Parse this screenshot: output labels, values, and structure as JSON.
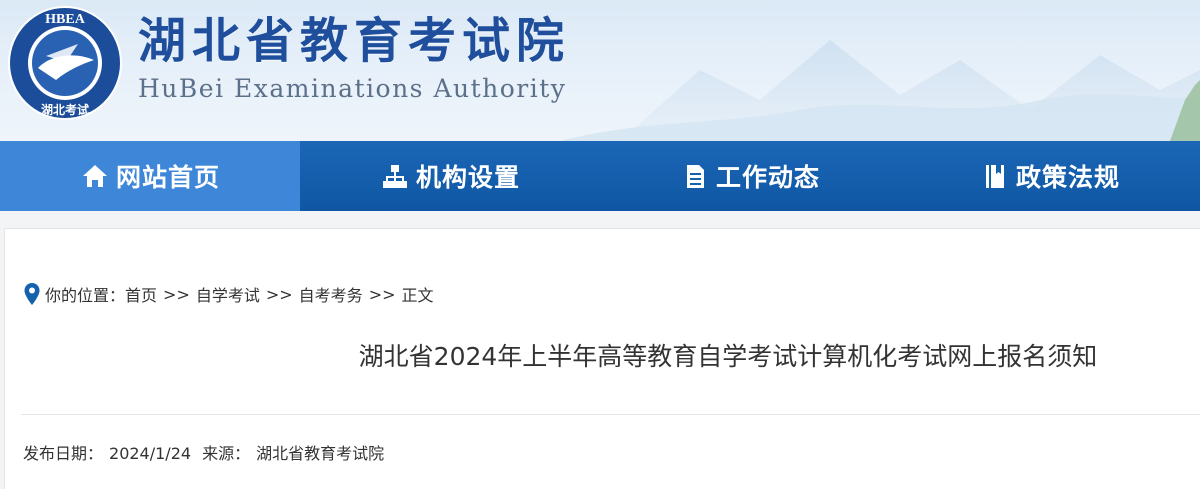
{
  "header": {
    "title": "湖北省教育考试院",
    "subtitle": "HuBei Examinations Authority",
    "logo": {
      "top_text": "HBEA",
      "bottom_text": "湖北考试"
    },
    "colors": {
      "title": "#1f4f9c",
      "subtitle": "#5d7089"
    }
  },
  "nav": {
    "items": [
      {
        "label": "网站首页",
        "icon": "home-icon",
        "active": true
      },
      {
        "label": "机构设置",
        "icon": "sitemap-icon",
        "active": false
      },
      {
        "label": "工作动态",
        "icon": "document-icon",
        "active": false
      },
      {
        "label": "政策法规",
        "icon": "book-icon",
        "active": false
      }
    ],
    "colors": {
      "bar": "#1262ae",
      "active": "#3e86d8"
    }
  },
  "breadcrumb": {
    "prefix": "你的位置：",
    "items": [
      "首页",
      "自学考试",
      "自考考务",
      "正文"
    ],
    "separator": ">>",
    "icon": "location-pin-icon"
  },
  "article": {
    "title": "湖北省2024年上半年高等教育自学考试计算机化考试网上报名须知",
    "publish_label": "发布日期：",
    "publish_date": "2024/1/24",
    "source_label": "来源：",
    "source": "湖北省教育考试院"
  }
}
